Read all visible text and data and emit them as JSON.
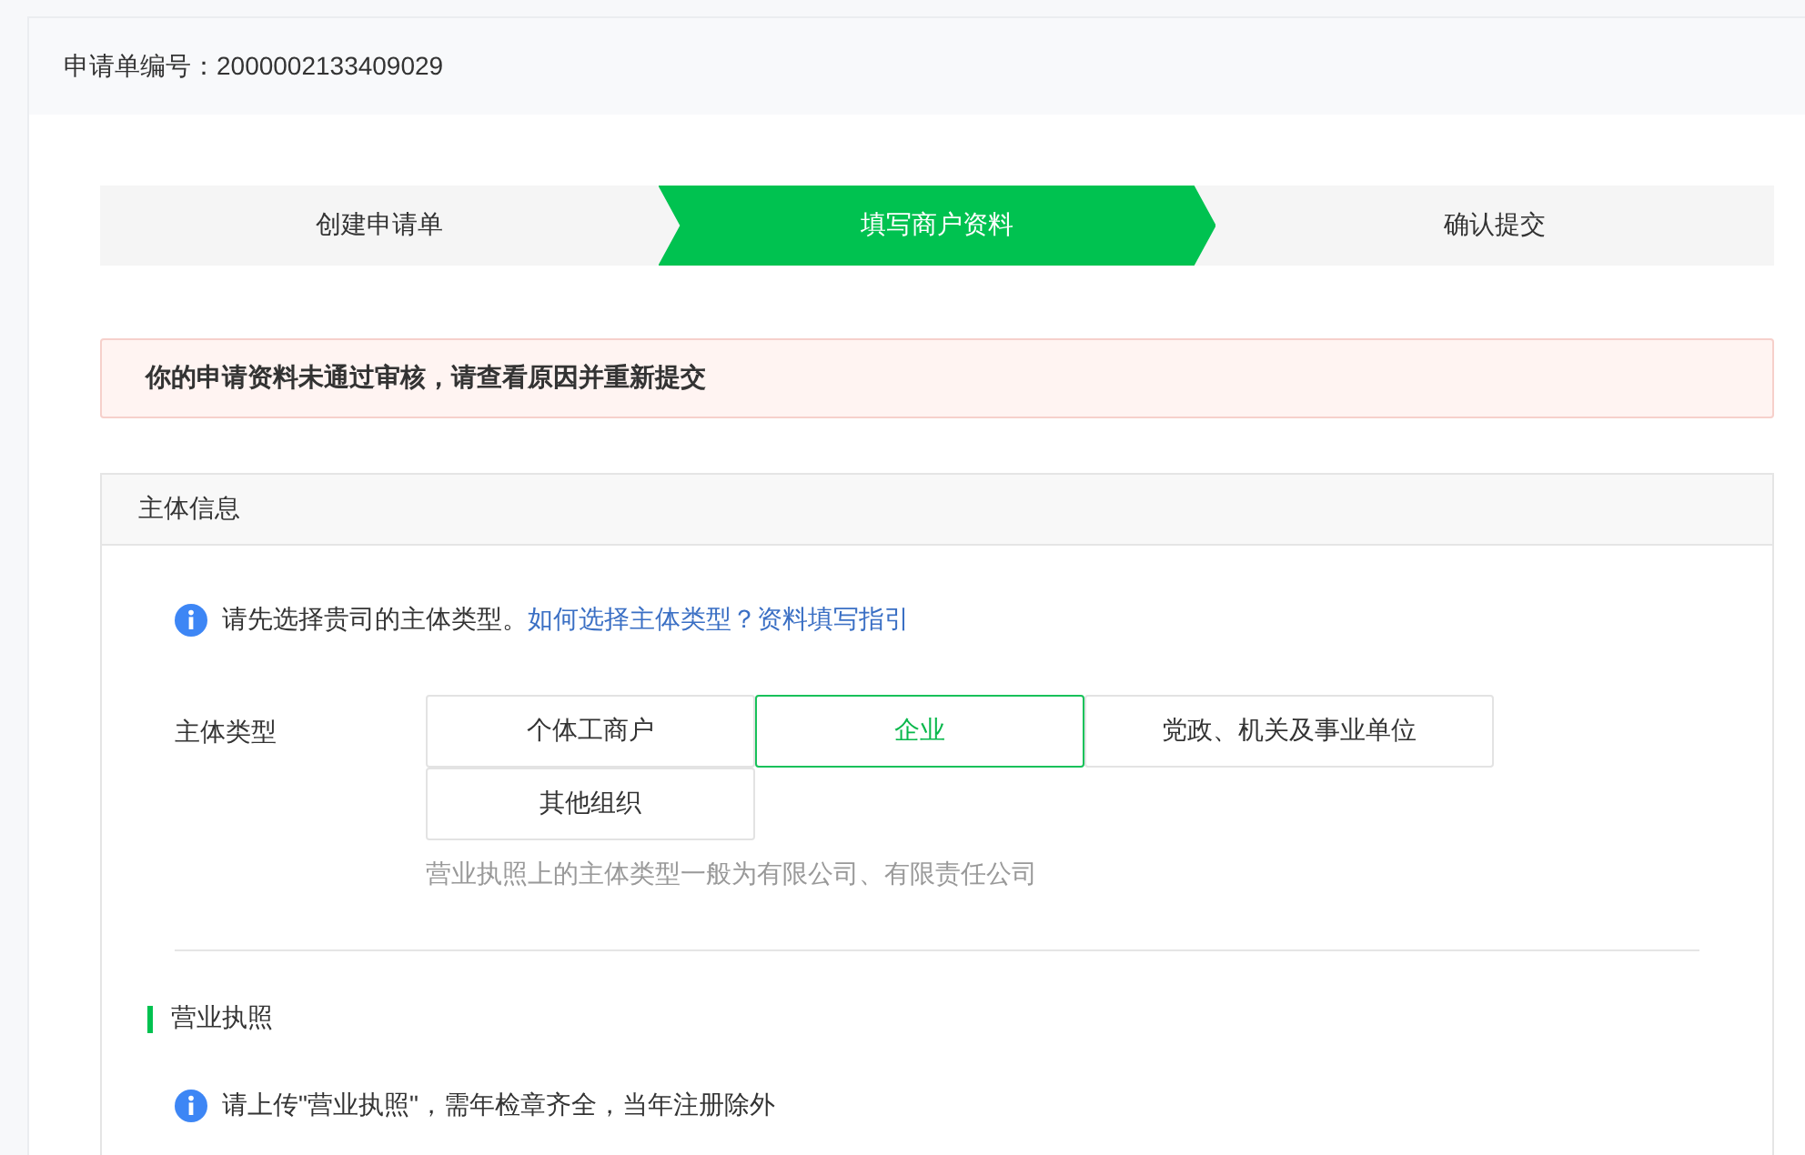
{
  "header": {
    "order_number": "申请单编号：2000002133409029"
  },
  "steps": [
    {
      "label": "创建申请单",
      "selected": false
    },
    {
      "label": "填写商户资料",
      "selected": true
    },
    {
      "label": "确认提交",
      "selected": false
    }
  ],
  "alert": {
    "message": "你的申请资料未通过审核，请查看原因并重新提交"
  },
  "panel": {
    "title": "主体信息",
    "info": {
      "text": "请先选择贵司的主体类型。",
      "link": "如何选择主体类型？资料填写指引"
    },
    "subject_type": {
      "label": "主体类型",
      "options": [
        {
          "label": "个体工商户",
          "selected": false
        },
        {
          "label": "企业",
          "selected": true
        },
        {
          "label": "党政、机关及事业单位",
          "selected": false
        },
        {
          "label": "其他组织",
          "selected": false
        }
      ],
      "hint": "营业执照上的主体类型一般为有限公司、有限责任公司"
    },
    "section": {
      "title": "营业执照",
      "info": "请上传\"营业执照\"，需年检章齐全，当年注册除外"
    }
  }
}
